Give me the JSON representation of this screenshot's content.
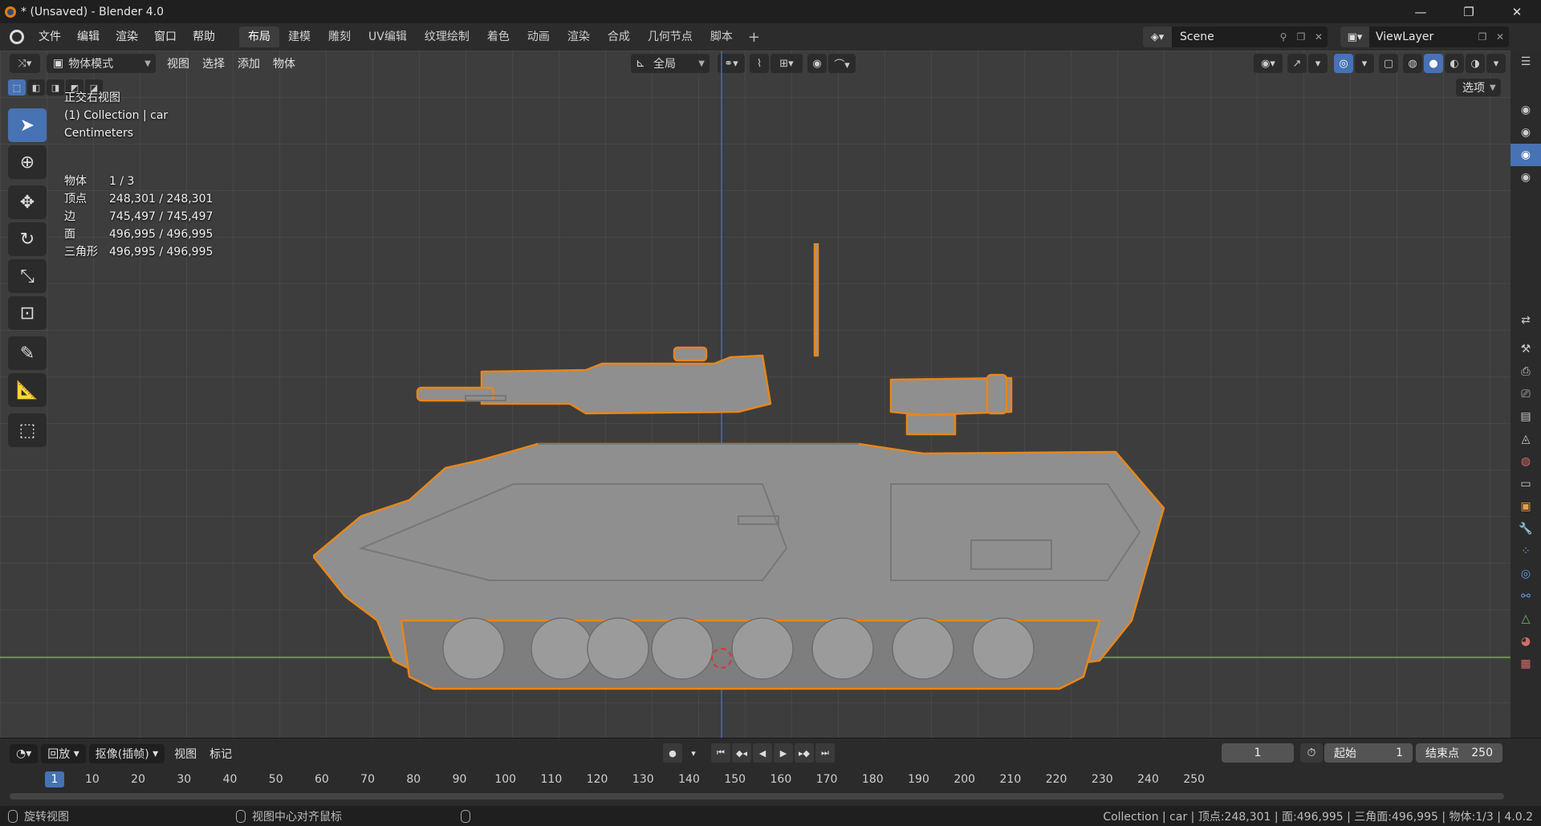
{
  "window": {
    "title": "* (Unsaved) - Blender 4.0",
    "controls": [
      "—",
      "❐",
      "✕"
    ]
  },
  "menus": [
    "文件",
    "编辑",
    "渲染",
    "窗口",
    "帮助"
  ],
  "workspaces": [
    "布局",
    "建模",
    "雕刻",
    "UV编辑",
    "纹理绘制",
    "着色",
    "动画",
    "渲染",
    "合成",
    "几何节点",
    "脚本"
  ],
  "active_workspace": "布局",
  "scene": {
    "name": "Scene"
  },
  "view_layer": {
    "name": "ViewLayer"
  },
  "viewport": {
    "mode": "物体模式",
    "menus": [
      "视图",
      "选择",
      "添加",
      "物体"
    ],
    "transform_orientation": "全局",
    "options_label": "选项",
    "overlay": {
      "view_name": "正交右视图",
      "collection_line": "(1) Collection | car",
      "units": "Centimeters"
    },
    "stats": [
      {
        "label": "物体",
        "value": "1 / 3"
      },
      {
        "label": "顶点",
        "value": "248,301 / 248,301"
      },
      {
        "label": "边",
        "value": "745,497 / 745,497"
      },
      {
        "label": "面",
        "value": "496,995 / 496,995"
      },
      {
        "label": "三角形",
        "value": "496,995 / 496,995"
      }
    ]
  },
  "timeline": {
    "playback_label": "回放",
    "keying_label": "抠像(插帧)",
    "view_label": "视图",
    "marker_label": "标记",
    "current_frame": "1",
    "start_label": "起始",
    "start_value": "1",
    "end_label": "结束点",
    "end_value": "250",
    "ruler_ticks": [
      "1",
      "10",
      "20",
      "30",
      "40",
      "50",
      "60",
      "70",
      "80",
      "90",
      "100",
      "110",
      "120",
      "130",
      "140",
      "150",
      "160",
      "170",
      "180",
      "190",
      "200",
      "210",
      "220",
      "230",
      "240",
      "250"
    ]
  },
  "statusbar": {
    "left_hint": "旋转视图",
    "mid_hint": "视图中心对齐鼠标",
    "right_info": "Collection | car | 顶点:248,301 | 面:496,995 | 三角面:496,995 | 物体:1/3 | 4.0.2"
  },
  "colors": {
    "accent": "#4772b3",
    "selection_outline": "#e8861a",
    "axis_x": "#6e9a28",
    "axis_y": "#3a6bb8"
  }
}
